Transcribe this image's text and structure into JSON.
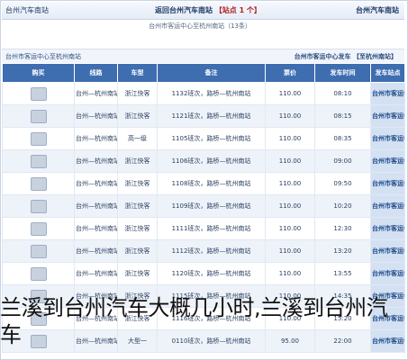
{
  "topbar": {
    "left": "台州汽车南站",
    "middle_prefix": "返回台州汽车南站 ",
    "middle_count": "【站点 1 个】",
    "right": "台州汽车南站"
  },
  "subtitle": {
    "left": "",
    "right": "台州市客运中心至杭州南站（13条）"
  },
  "section": {
    "left": "台州市客运中心至杭州南站",
    "right": "台州市客运中心发车 【至杭州南站】"
  },
  "table": {
    "headers": [
      "发车站点",
      "发车时间",
      "票价",
      "备注",
      "车型",
      "线路",
      "购买"
    ],
    "rows": [
      {
        "station": "台州市客运中心",
        "time": "08:10",
        "price": "110.00",
        "remark": "1132班次，路桥—杭州南站",
        "vehicle": "浙江快客",
        "route": "台州—杭州南站"
      },
      {
        "station": "台州市客运中心",
        "time": "08:15",
        "price": "110.00",
        "remark": "1121班次，路桥—杭州南站",
        "vehicle": "浙江快客",
        "route": "台州—杭州南站"
      },
      {
        "station": "台州市客运中心",
        "time": "08:35",
        "price": "110.00",
        "remark": "1105班次，路桥—杭州南站",
        "vehicle": "高一级",
        "route": "台州—杭州南站"
      },
      {
        "station": "台州市客运中心",
        "time": "09:00",
        "price": "110.00",
        "remark": "1106班次，路桥—杭州南站",
        "vehicle": "浙江快客",
        "route": "台州—杭州南站"
      },
      {
        "station": "台州市客运中心",
        "time": "09:50",
        "price": "110.00",
        "remark": "1108班次，路桥—杭州南站",
        "vehicle": "浙江快客",
        "route": "台州—杭州南站"
      },
      {
        "station": "台州市客运中心",
        "time": "10:20",
        "price": "110.00",
        "remark": "1109班次，路桥—杭州南站",
        "vehicle": "浙江快客",
        "route": "台州—杭州南站"
      },
      {
        "station": "台州市客运中心",
        "time": "12:30",
        "price": "110.00",
        "remark": "1111班次，路桥—杭州南站",
        "vehicle": "浙江快客",
        "route": "台州—杭州南站"
      },
      {
        "station": "台州市客运中心",
        "time": "13:20",
        "price": "110.00",
        "remark": "1112班次，路桥—杭州南站",
        "vehicle": "浙江快客",
        "route": "台州—杭州南站"
      },
      {
        "station": "台州市客运中心",
        "time": "13:55",
        "price": "110.00",
        "remark": "1120班次，路桥—杭州南站",
        "vehicle": "浙江快客",
        "route": "台州—杭州南站"
      },
      {
        "station": "台州市客运中心",
        "time": "14:35",
        "price": "110.00",
        "remark": "1115班次，路桥—杭州南站",
        "vehicle": "浙江快客",
        "route": "台州—杭州南站"
      },
      {
        "station": "台州市客运中心",
        "time": "15:20",
        "price": "110.00",
        "remark": "1116班次，路桥—杭州南站",
        "vehicle": "浙江快客",
        "route": "台州—杭州南站"
      },
      {
        "station": "台州市客运中心",
        "time": "22:00",
        "price": "95.00",
        "remark": "0110班次，路桥—杭州南站",
        "vehicle": "大型一",
        "route": "台州—杭州南站"
      }
    ]
  },
  "caption": "兰溪到台州汽车大概几小时,兰溪到台州汽车"
}
